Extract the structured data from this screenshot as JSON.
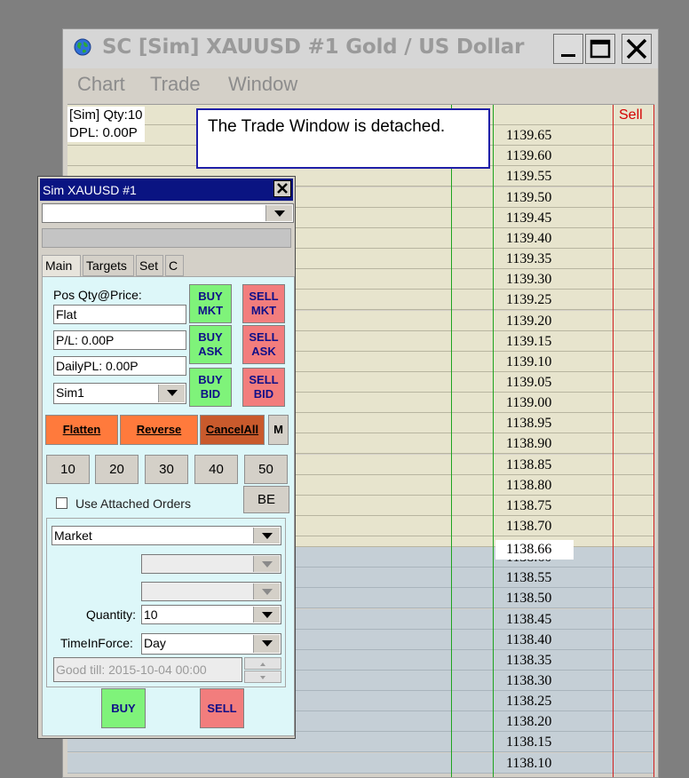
{
  "window": {
    "title": "SC [Sim] XAUUSD  #1  Gold / US Dollar",
    "menu": [
      "Chart",
      "Trade",
      "Window"
    ]
  },
  "chart": {
    "info_line1": "[Sim]  Qty:10",
    "info_line2": "DPL: 0.00P",
    "sell_header": "Sell",
    "current_price": "1138.66",
    "prices_upper": [
      "1139.65",
      "1139.60",
      "1139.55",
      "1139.50",
      "1139.45",
      "1139.40",
      "1139.35",
      "1139.30",
      "1139.25",
      "1139.20",
      "1139.15",
      "1139.10",
      "1139.05",
      "1139.00",
      "1138.95",
      "1138.90",
      "1138.85",
      "1138.80",
      "1138.75",
      "1138.70"
    ],
    "prices_lower": [
      "1138.60",
      "1138.55",
      "1138.50",
      "1138.45",
      "1138.40",
      "1138.35",
      "1138.30",
      "1138.25",
      "1138.20",
      "1138.15",
      "1138.10"
    ],
    "detached_message": "The Trade Window is detached."
  },
  "trade_window": {
    "title": "Sim XAUUSD  #1",
    "tabs": [
      "Main",
      "Targets",
      "Set",
      "C"
    ],
    "pos_label": "Pos Qty@Price:",
    "pos_value": "Flat",
    "pl_value": "P/L: 0.00P",
    "daily_pl_value": "DailyPL: 0.00P",
    "account": "Sim1",
    "buy_mkt": [
      "BUY",
      "MKT"
    ],
    "sell_mkt": [
      "SELL",
      "MKT"
    ],
    "buy_ask": [
      "BUY",
      "ASK"
    ],
    "sell_ask": [
      "SELL",
      "ASK"
    ],
    "buy_bid": [
      "BUY",
      "BID"
    ],
    "sell_bid": [
      "SELL",
      "BID"
    ],
    "flatten": "Flatten",
    "reverse": "Reverse",
    "cancel_all": "CancelAll",
    "m_button": "M",
    "qty_buttons": [
      "10",
      "20",
      "30",
      "40",
      "50"
    ],
    "use_attached_orders": "Use Attached Orders",
    "be_button": "BE",
    "order_type": "Market",
    "quantity_label": "Quantity:",
    "quantity_value": "10",
    "tif_label": "TimeInForce:",
    "tif_value": "Day",
    "good_till": "Good till: 2015-10-04 00:00",
    "buy_button": "BUY",
    "sell_button": "SELL"
  },
  "colors": {
    "title_bar": "#0a1482",
    "buy": "#7ff37a",
    "sell": "#f27d7d",
    "action": "#ff7a3c",
    "panel": "#ddf7f9"
  }
}
